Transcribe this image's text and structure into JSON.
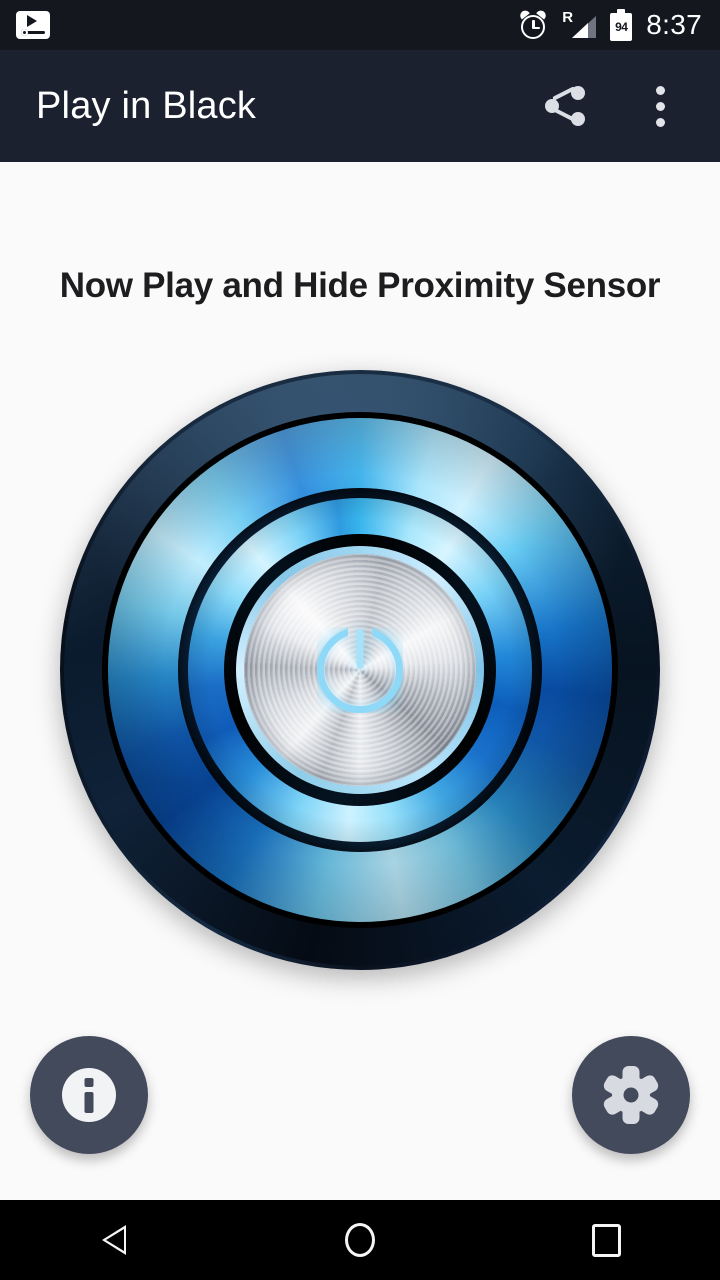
{
  "status_bar": {
    "notification_icon": "media-player-icon",
    "alarm_icon": "alarm-clock-icon",
    "network": {
      "icon": "signal-roaming-icon",
      "roaming_label": "R"
    },
    "battery": {
      "icon": "battery-icon",
      "level": "94"
    },
    "time": "8:37"
  },
  "app_bar": {
    "title": "Play in Black",
    "share_icon": "share-icon",
    "overflow_icon": "more-vert-icon"
  },
  "main": {
    "headline": "Now Play and Hide Proximity Sensor",
    "power_button": {
      "name": "power-button",
      "glyph": "power-icon",
      "state": "on"
    },
    "info_button": {
      "label": "Info",
      "icon": "info-icon"
    },
    "settings_button": {
      "label": "Settings",
      "icon": "gear-icon"
    }
  },
  "nav_bar": {
    "back": "back-icon",
    "home": "home-icon",
    "recents": "recents-icon"
  },
  "colors": {
    "status_bar_bg": "#15171f",
    "app_bar_bg": "#1c2130",
    "page_bg": "#fafafa",
    "fab_bg": "#434a5c",
    "accent_blue": "#23a7e8",
    "glow_blue": "#8ed9f7",
    "nav_bar_bg": "#000000",
    "headline_color": "#1d1d1f"
  }
}
